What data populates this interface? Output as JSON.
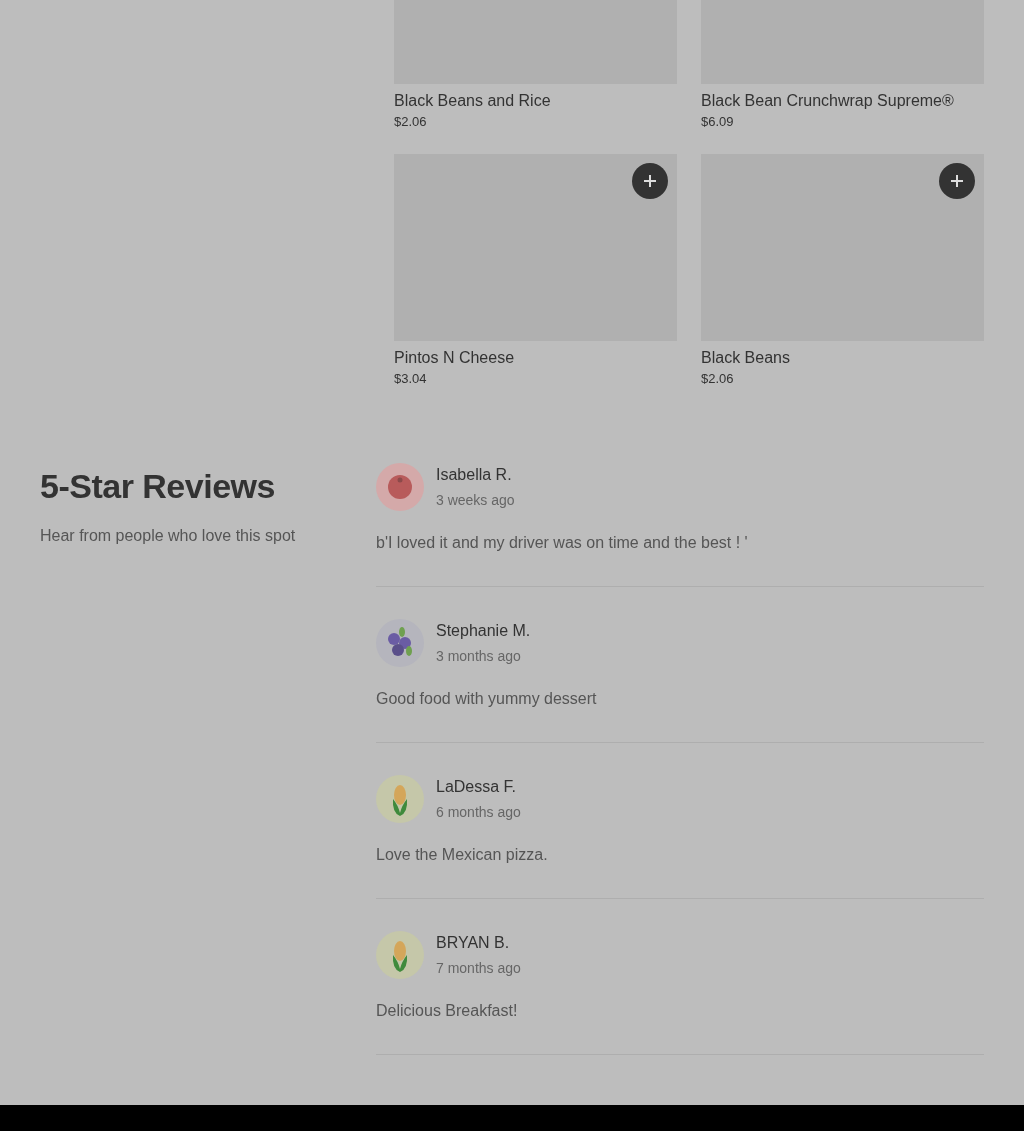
{
  "menu_items": [
    {
      "name": "Black Beans and Rice",
      "price": "$2.06",
      "add_button": false
    },
    {
      "name": "Black Bean Crunchwrap Supreme®",
      "price": "$6.09",
      "add_button": false
    },
    {
      "name": "Pintos N Cheese",
      "price": "$3.04",
      "add_button": true
    },
    {
      "name": "Black Beans",
      "price": "$2.06",
      "add_button": true
    }
  ],
  "reviews_section": {
    "title": "5-Star Reviews",
    "subtitle": "Hear from people who love this spot"
  },
  "reviews": [
    {
      "kind": "tomato",
      "name": "Isabella R.",
      "time": "3 weeks ago",
      "text": "b'I loved it and my driver was on time and the best ! '"
    },
    {
      "kind": "berry",
      "name": "Stephanie M.",
      "time": "3 months ago",
      "text": "Good food with yummy dessert"
    },
    {
      "kind": "corn",
      "name": "LaDessa F.",
      "time": "6 months ago",
      "text": "Love the Mexican pizza."
    },
    {
      "kind": "corn",
      "name": "BRYAN B.",
      "time": "7 months ago",
      "text": "Delicious Breakfast!"
    }
  ]
}
